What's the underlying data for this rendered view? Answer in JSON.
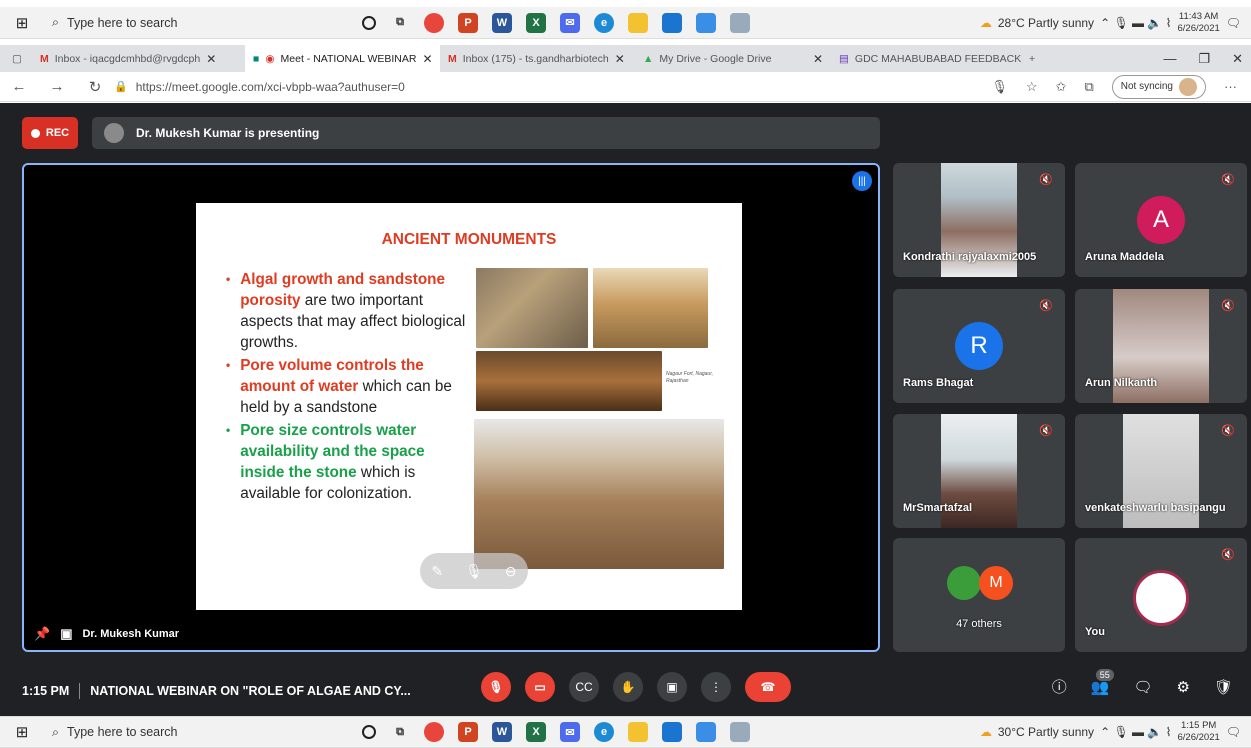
{
  "taskbar_top": {
    "search_placeholder": "Type here to search",
    "weather": "28°C  Partly sunny",
    "time": "11:43 AM",
    "date": "6/26/2021"
  },
  "taskbar_bottom": {
    "search_placeholder": "Type here to search",
    "weather": "30°C  Partly sunny",
    "time": "1:15 PM",
    "date": "6/26/2021"
  },
  "browser": {
    "tabs": [
      {
        "label": "Inbox - iqacgdcmhbd@rvgdcph"
      },
      {
        "label": "Meet - NATIONAL WEBINAR"
      },
      {
        "label": "Inbox (175) - ts.gandharbiotech"
      },
      {
        "label": "My Drive - Google Drive"
      },
      {
        "label": "GDC MAHABUBABAD FEEDBACK"
      }
    ],
    "url": "https://meet.google.com/xci-vbpb-waa?authuser=0",
    "sync_label": "Not syncing"
  },
  "meet": {
    "rec_label": "REC",
    "presenting_text": "Dr. Mukesh Kumar is presenting",
    "main_name": "Dr. Mukesh Kumar",
    "slide": {
      "title": "ANCIENT MONUMENTS",
      "b1_red": "Algal growth and sandstone porosity",
      "b1_rest": " are two important aspects that may affect biological growths.",
      "b2_red": "Pore volume controls the amount of water",
      "b2_rest": " which can be held by a sandstone",
      "b3_green": "Pore size controls water availability and the space inside the stone",
      "b3_rest": " which is available for colonization.",
      "caption": "Nagaur Fort, Nagaur, Rajasthan"
    },
    "participants": [
      {
        "name": "Kondrathi rajyalaxmi2005"
      },
      {
        "name": "Aruna Maddela",
        "initial": "A"
      },
      {
        "name": "Rams Bhagat",
        "initial": "R"
      },
      {
        "name": "Arun Nilkanth"
      },
      {
        "name": "MrSmartafzal"
      },
      {
        "name": "venkateshwarlu basipangu"
      },
      {
        "name": "47 others",
        "initial": "M"
      },
      {
        "name": "You"
      }
    ],
    "time": "1:15 PM",
    "meeting_title": "NATIONAL WEBINAR ON \"ROLE OF ALGAE AND CY...",
    "people_count": "55"
  },
  "colors": {
    "accent_blue": "#8ab4f8",
    "hangup_red": "#ea4335",
    "aruna_avatar": "#d01c5b",
    "rams_avatar": "#1a73e8"
  }
}
